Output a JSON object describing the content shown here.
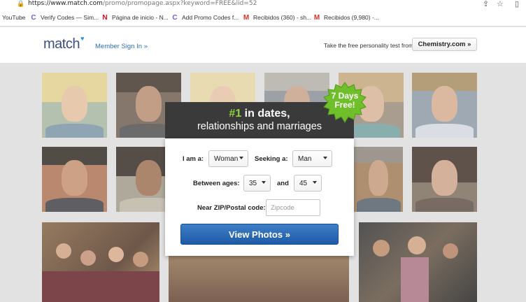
{
  "browser": {
    "url_host": "https://www.match.com",
    "url_path": "/promo/promopage.aspx?keyword=FREE&lid=52",
    "bookmarks": [
      {
        "label": "YouTube",
        "icon": "youtube-icon"
      },
      {
        "label": "Verify Codes — Sim...",
        "icon": "google-icon"
      },
      {
        "label": "Página de inicio - N...",
        "icon": "netflix-icon"
      },
      {
        "label": "Add Promo Codes f...",
        "icon": "google-icon"
      },
      {
        "label": "Recibidos (360) - sh...",
        "icon": "gmail-icon"
      },
      {
        "label": "Recibidos (9,980) -...",
        "icon": "gmail-icon"
      }
    ]
  },
  "header": {
    "logo": "match",
    "signin": "Member Sign In »",
    "tagline": "Take the free personality test from",
    "chemistry": "Chemistry.com »"
  },
  "modal": {
    "headline_num": "#1",
    "headline_rest": " in dates,",
    "headline_line2": "relationships and marriages",
    "badge_line1": "7 Days",
    "badge_line2": "Free!",
    "iam_label": "I am a:",
    "iam_value": "Woman",
    "seeking_label": "Seeking a:",
    "seeking_value": "Man",
    "ages_label": "Between ages:",
    "age_min": "35",
    "and_label": "and",
    "age_max": "45",
    "zip_label": "Near ZIP/Postal code:",
    "zip_placeholder": "Zipcode",
    "button": "View Photos »"
  },
  "colors": {
    "accent_green": "#8fd33c",
    "button_blue": "#2a6bb8",
    "header_dark": "#3a3a3a",
    "logo_blue": "#3b4f86"
  }
}
